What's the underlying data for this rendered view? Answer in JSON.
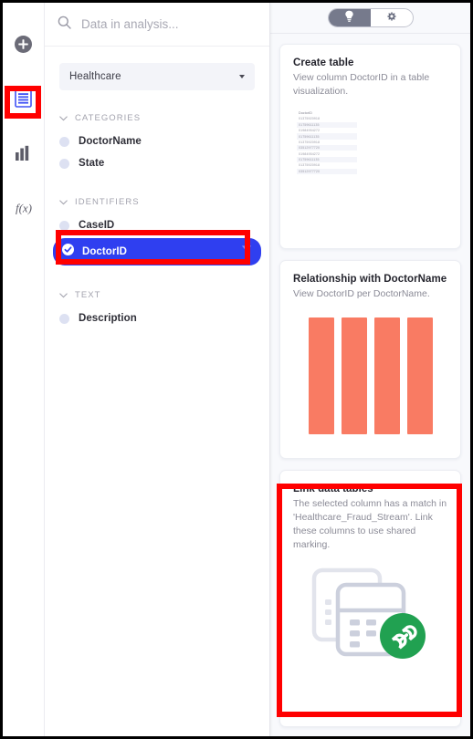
{
  "rail": {
    "items": [
      {
        "name": "add-icon",
        "label": "Add"
      },
      {
        "name": "data-table-icon",
        "label": "Data in analysis",
        "selected": true
      },
      {
        "name": "bar-chart-icon",
        "label": "Visualizations"
      },
      {
        "name": "function-icon",
        "label": "f(x)"
      }
    ]
  },
  "sidebar": {
    "search": {
      "placeholder": "Data in analysis...",
      "value": ""
    },
    "table_select": {
      "value": "Healthcare"
    },
    "groups": [
      {
        "title": "CATEGORIES",
        "columns": [
          {
            "label": "DoctorName",
            "selected": false
          },
          {
            "label": "State",
            "selected": false
          }
        ]
      },
      {
        "title": "IDENTIFIERS",
        "columns": [
          {
            "label": "CaseID",
            "selected": false
          },
          {
            "label": "DoctorID",
            "selected": true
          }
        ]
      },
      {
        "title": "TEXT",
        "columns": [
          {
            "label": "Description",
            "selected": false
          }
        ]
      }
    ]
  },
  "right_panel": {
    "toggle": {
      "left": {
        "icon": "lightbulb-icon",
        "label": "Recommendations",
        "active": true
      },
      "right": {
        "icon": "gear-icon",
        "label": "Settings",
        "active": false
      }
    },
    "cards": [
      {
        "id": "create-table",
        "title": "Create table",
        "description": "View column DoctorID in a table visualization.",
        "preview": {
          "type": "table",
          "column_header": "DoctorID",
          "rows": [
            "01375920918",
            "01759611135",
            "01984954272",
            "01759611135",
            "01375920918",
            "03512977720",
            "01984954272",
            "01759611135",
            "01375920918",
            "03512977720"
          ]
        }
      },
      {
        "id": "relationship-doctorname",
        "title": "Relationship with DoctorName",
        "description": "View DoctorID per DoctorName.",
        "preview": {
          "type": "bar",
          "bar_color": "#f97b63",
          "values": [
            100,
            100,
            100,
            100
          ]
        }
      },
      {
        "id": "link-data-tables",
        "title": "Link data tables",
        "description": "The selected column has a match in 'Healthcare_Fraud_Stream'. Link these columns to use shared marking.",
        "preview": {
          "type": "illustration",
          "icons": [
            "data-tables-icon",
            "link-badge-icon"
          ],
          "badge_color": "#21a151"
        }
      }
    ]
  },
  "annotations": {
    "color": "#ff0000",
    "boxes": [
      {
        "target": "rail-item-data-table",
        "label": "Data in analysis rail icon"
      },
      {
        "target": "column-doctorid",
        "label": "Selected DoctorID column"
      },
      {
        "target": "card-link-data-tables",
        "label": "Link data tables card"
      }
    ]
  },
  "colors": {
    "selected_pill": "#2f3ff0",
    "bar": "#f97b63",
    "link_badge": "#21a151",
    "panel_bg": "#f8f9fc",
    "annotation": "#ff0000"
  }
}
